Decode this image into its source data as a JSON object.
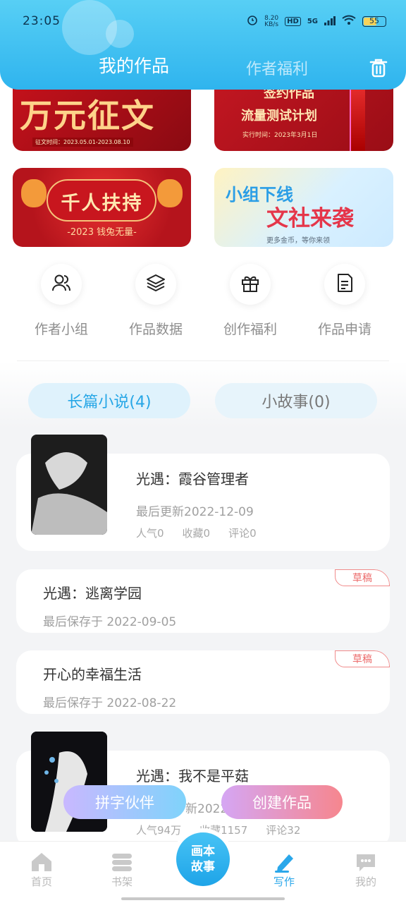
{
  "status": {
    "time": "23:05",
    "net_speed_value": "8.20",
    "net_speed_unit": "KB/s",
    "hd": "HD",
    "signal": "5G",
    "battery": "55"
  },
  "header": {
    "tab_active": "我的作品",
    "tab_inactive": "作者福利"
  },
  "banners": {
    "b1_title": "万元征文",
    "b1_small": "征文时间：2023.05.01-2023.08.10",
    "b2_line1": "签约作品",
    "b2_line2": "流量测试计划",
    "b2_line3": "实行时间：2023年3月1日",
    "b3_title": "千人扶持",
    "b3_sub": "-2023 钱兔无量-",
    "b4_line1": "小组下线",
    "b4_line2": "文社来袭",
    "b4_line3": "更多金币，等你来领"
  },
  "menu": [
    {
      "label": "作者小组",
      "icon": "group-icon"
    },
    {
      "label": "作品数据",
      "icon": "layers-icon"
    },
    {
      "label": "创作福利",
      "icon": "gift-icon"
    },
    {
      "label": "作品申请",
      "icon": "document-icon"
    }
  ],
  "pills": {
    "long": "长篇小说(4)",
    "short": "小故事(0)"
  },
  "works": [
    {
      "title": "光遇：霞谷管理者",
      "updated": "最后更新2022-12-09",
      "pop": "人气0",
      "fav": "收藏0",
      "comment": "评论0"
    },
    {
      "title": "光遇：逃离学园",
      "saved": "最后保存于 2022-09-05",
      "badge": "草稿"
    },
    {
      "title": "开心的幸福生活",
      "saved": "最后保存于 2022-08-22",
      "badge": "草稿"
    },
    {
      "title": "光遇：我不是平菇",
      "updated_partial": "新2022",
      "pop": "人气94万",
      "fav": "收藏1157",
      "comment": "评论32"
    }
  ],
  "floating": {
    "partner": "拼字伙伴",
    "create": "创建作品"
  },
  "nav": {
    "home": "首页",
    "shelf": "书架",
    "center_line1": "画本",
    "center_line2": "故事",
    "write": "写作",
    "mine": "我的"
  },
  "colors": {
    "accent": "#2aa7ea",
    "header": "#3dbdf0",
    "draft": "#ec6b6b"
  }
}
